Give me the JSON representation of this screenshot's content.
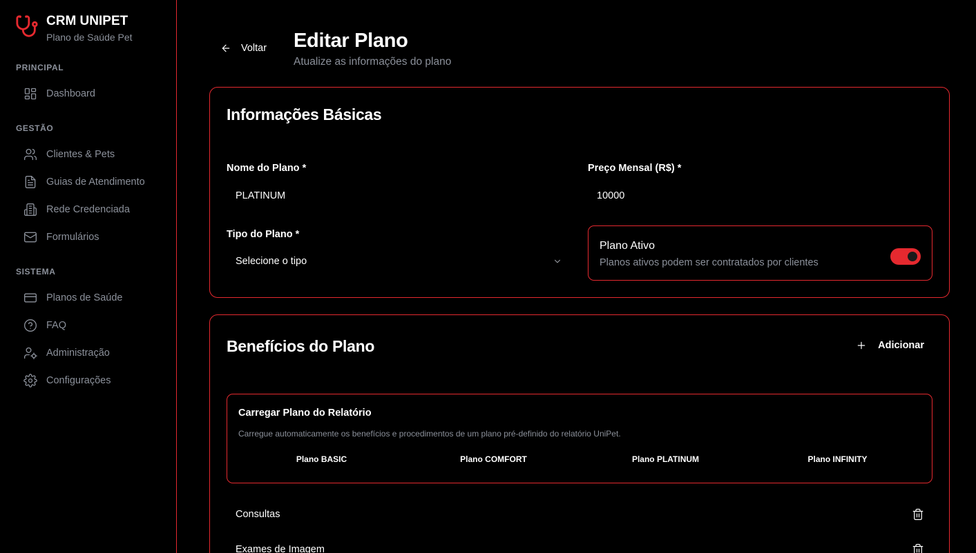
{
  "brand": {
    "title": "CRM UNIPET",
    "subtitle": "Plano de Saúde Pet",
    "icon": "stethoscope-icon",
    "accent": "#e5292f"
  },
  "sidebar": {
    "sections": [
      {
        "title": "PRINCIPAL",
        "items": [
          {
            "label": "Dashboard",
            "icon": "dashboard-icon"
          }
        ]
      },
      {
        "title": "GESTÃO",
        "items": [
          {
            "label": "Clientes & Pets",
            "icon": "users-icon"
          },
          {
            "label": "Guias de Atendimento",
            "icon": "document-icon"
          },
          {
            "label": "Rede Credenciada",
            "icon": "building-icon"
          },
          {
            "label": "Formulários",
            "icon": "mail-icon"
          }
        ]
      },
      {
        "title": "SISTEMA",
        "items": [
          {
            "label": "Planos de Saúde",
            "icon": "credit-card-icon"
          },
          {
            "label": "FAQ",
            "icon": "help-circle-icon"
          },
          {
            "label": "Administração",
            "icon": "user-cog-icon"
          },
          {
            "label": "Configurações",
            "icon": "gear-icon"
          }
        ]
      }
    ]
  },
  "header": {
    "back_label": "Voltar",
    "title": "Editar Plano",
    "subtitle": "Atualize as informações do plano"
  },
  "basic_info": {
    "title": "Informações Básicas",
    "name_label": "Nome do Plano *",
    "name_value": "PLATINUM",
    "price_label": "Preço Mensal (R$) *",
    "price_value": "10000",
    "type_label": "Tipo do Plano *",
    "type_value": "Selecione o tipo",
    "active_title": "Plano Ativo",
    "active_desc": "Planos ativos podem ser contratados por clientes",
    "active_on": true
  },
  "benefits": {
    "title": "Benefícios do Plano",
    "add_label": "Adicionar",
    "report": {
      "title": "Carregar Plano do Relatório",
      "desc": "Carregue automaticamente os benefícios e procedimentos de um plano pré-definido do relatório UniPet.",
      "plans": [
        "Plano BASIC",
        "Plano COMFORT",
        "Plano PLATINUM",
        "Plano INFINITY"
      ]
    },
    "items": [
      "Consultas",
      "Exames de Imagem"
    ]
  }
}
